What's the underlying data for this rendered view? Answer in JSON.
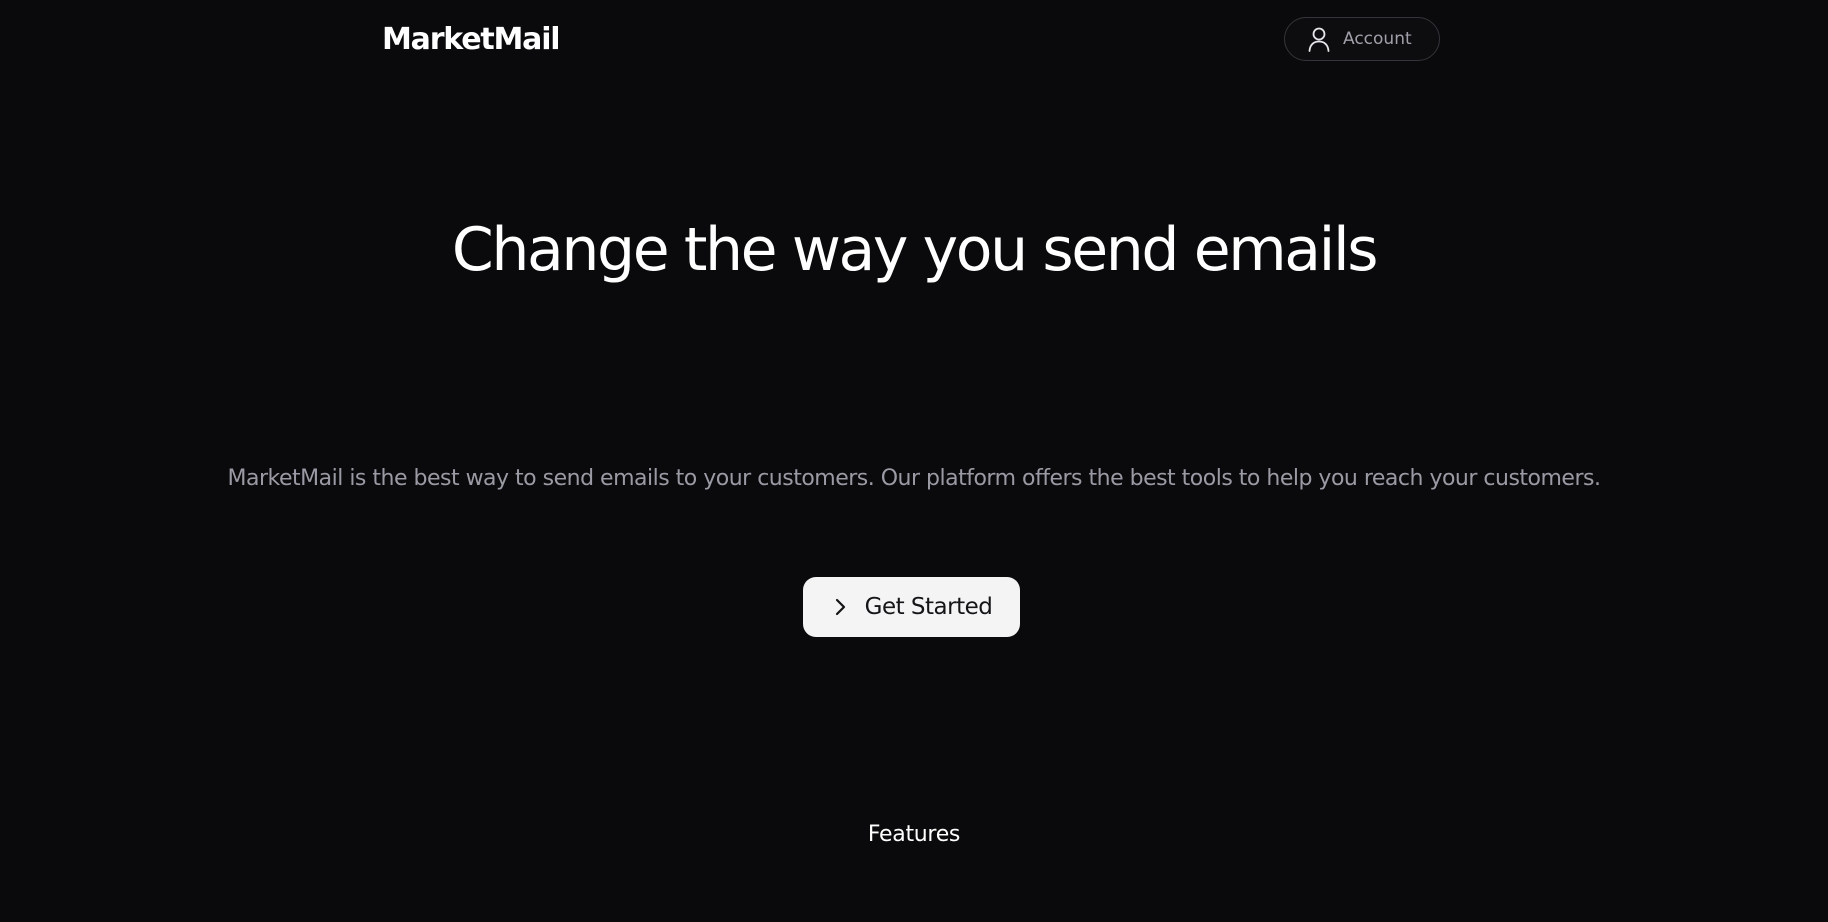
{
  "header": {
    "brand": "MarketMail",
    "account_label": "Account",
    "account_icon": "user-icon"
  },
  "hero": {
    "title": "Change the way you send emails",
    "subtitle": "MarketMail is the best way to send emails to your customers. Our platform offers the best tools to help you reach your customers.",
    "cta_label": "Get Started",
    "cta_icon": "chevron-right-icon"
  },
  "sections": {
    "features_label": "Features"
  },
  "colors": {
    "background": "#0a0a0c",
    "text_primary": "#ffffff",
    "text_muted": "#9a9aa4",
    "button_bg": "#f4f4f5"
  }
}
